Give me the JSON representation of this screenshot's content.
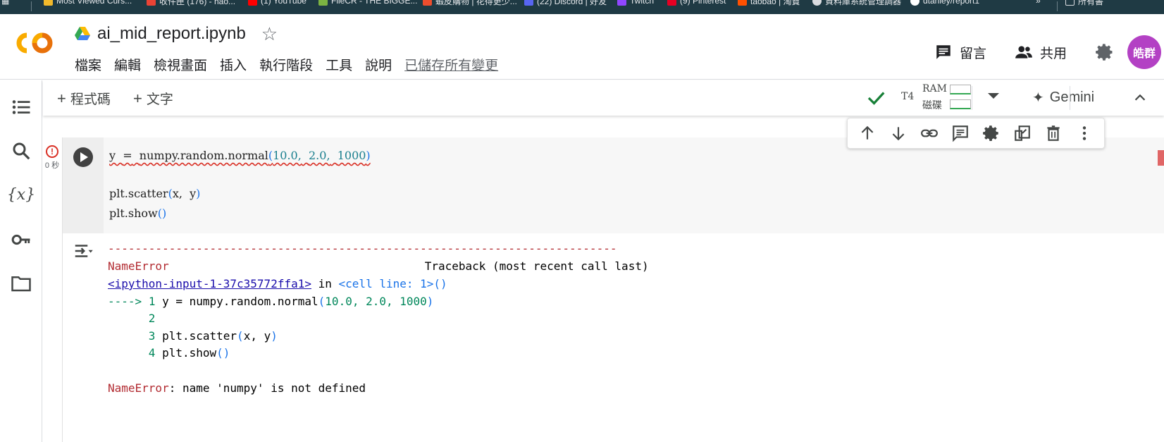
{
  "bookmarks": [
    {
      "label": "Most Viewed Curs...",
      "color": "#f2b92b"
    },
    {
      "label": "收件匣 (176) - hao...",
      "color": "#ea4335"
    },
    {
      "label": "(1) YouTube",
      "color": "#ff0000"
    },
    {
      "label": "FileCR - THE BIGGE...",
      "color": "#7cb342"
    },
    {
      "label": "蝦皮購物 | 花得更少...",
      "color": "#ee4d2d"
    },
    {
      "label": "(22) Discord | 好友",
      "color": "#5865f2"
    },
    {
      "label": "Twitch",
      "color": "#9146ff"
    },
    {
      "label": "(9) Pinterest",
      "color": "#e60023"
    },
    {
      "label": "taobao | 淘寶",
      "color": "#ff5000"
    },
    {
      "label": "資料庫系統管理調器",
      "color": "#dadce0"
    },
    {
      "label": "dtanley/report1",
      "color": "#ffffff"
    },
    {
      "label": "所有書",
      "color": "#dadce0"
    }
  ],
  "header": {
    "title": "ai_mid_report.ipynb",
    "menu": [
      "檔案",
      "編輯",
      "檢視畫面",
      "插入",
      "執行階段",
      "工具",
      "說明"
    ],
    "saved": "已儲存所有變更",
    "comment": "留言",
    "share": "共用",
    "avatar": "皓群"
  },
  "toolbar": {
    "add_code": "程式碼",
    "add_text": "文字",
    "gpu": "T4",
    "ram": "RAM",
    "disk": "磁碟",
    "gemini": "Gemini"
  },
  "cell": {
    "status_time": "0 秒",
    "code": {
      "line1_var": "y",
      "line1_op": "=",
      "line1_call": "numpy.random.normal",
      "line1_a": "10.0,",
      "line1_b": "2.0,",
      "line1_c": "1000",
      "line3_call": "plt.scatter",
      "line3_args": "x,",
      "line3_y": "y",
      "line4_call": "plt.show"
    },
    "output": {
      "dashes": "---------------------------------------------------------------------------",
      "err_name": "NameError",
      "traceback_hdr": "Traceback (most recent call last)",
      "input_link": "<ipython-input-1-37c35772ffa1>",
      "in_word": "in",
      "cell_line": "<cell line: 1>",
      "arrow": "---->",
      "lines": [
        {
          "n": "1",
          "code": "y = numpy.random.normal"
        },
        {
          "n": "2",
          "code": ""
        },
        {
          "n": "3",
          "code": "plt.scatter"
        },
        {
          "n": "4",
          "code": "plt.show"
        }
      ],
      "line1_args": "10.0, 2.0, 1000",
      "line3_args": "x, y",
      "final_error_name": "NameError",
      "final_error_msg": ": name 'numpy' is not defined"
    }
  },
  "colors": {
    "error_red": "#b22b31",
    "number_green": "#00875a",
    "paren_blue": "#1a73e8",
    "avatar_purple": "#b341c4"
  }
}
